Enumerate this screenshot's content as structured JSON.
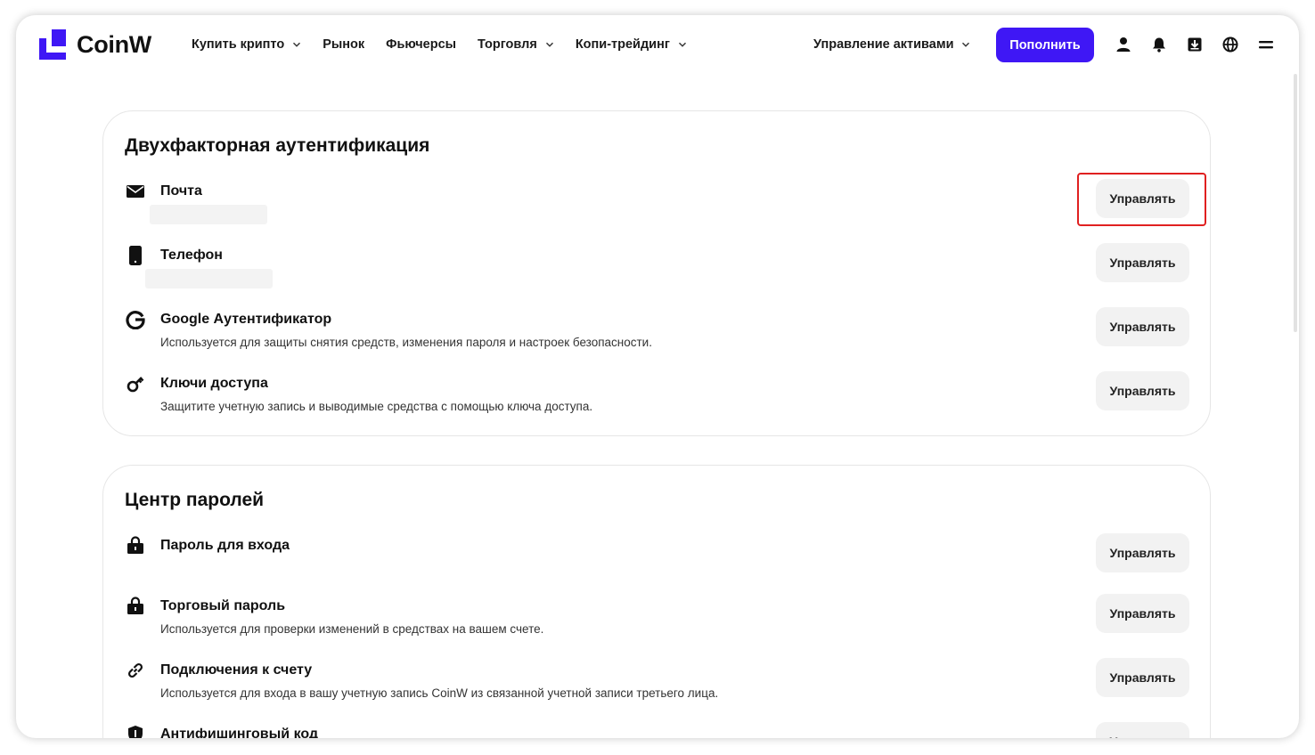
{
  "app": {
    "name": "CoinW",
    "accent_color": "#3f17f5"
  },
  "header": {
    "nav": [
      {
        "label": "Купить крипто",
        "has_dropdown": true
      },
      {
        "label": "Рынок",
        "has_dropdown": false
      },
      {
        "label": "Фьючерсы",
        "has_dropdown": false
      },
      {
        "label": "Торговля",
        "has_dropdown": true
      },
      {
        "label": "Копи-трейдинг",
        "has_dropdown": true
      }
    ],
    "assets_label": "Управление активами",
    "deposit_label": "Пополнить",
    "icons": [
      "user-icon",
      "bell-icon",
      "download-icon",
      "globe-icon",
      "menu-icon"
    ]
  },
  "two_factor": {
    "title": "Двухфакторная аутентификация",
    "items": [
      {
        "title": "Почта",
        "description": "",
        "icon": "mail-icon",
        "button": "Управлять",
        "value_hidden": true
      },
      {
        "title": "Телефон",
        "description": "",
        "icon": "phone-icon",
        "button": "Управлять",
        "value_hidden": true
      },
      {
        "title": "Google Аутентификатор",
        "description": "Используется для защиты снятия средств, изменения пароля и настроек безопасности.",
        "icon": "google-icon",
        "button": "Управлять"
      },
      {
        "title": "Ключи доступа",
        "description": "Защитите учетную запись и выводимые средства с помощью ключа доступа.",
        "icon": "key-icon",
        "button": "Управлять"
      }
    ]
  },
  "password_center": {
    "title": "Центр паролей",
    "items": [
      {
        "title": "Пароль для входа",
        "description": "",
        "icon": "lock-icon",
        "button": "Управлять"
      },
      {
        "title": "Торговый пароль",
        "description": "Используется для проверки изменений в средствах на вашем счете.",
        "icon": "lock-icon",
        "button": "Управлять"
      },
      {
        "title": "Подключения к счету",
        "description": "Используется для входа в вашу учетную запись CoinW из связанной учетной записи третьего лица.",
        "icon": "link-icon",
        "button": "Управлять"
      },
      {
        "title": "Антифишинговый код",
        "description": "",
        "icon": "shield-icon",
        "button": "Управлять"
      }
    ]
  }
}
